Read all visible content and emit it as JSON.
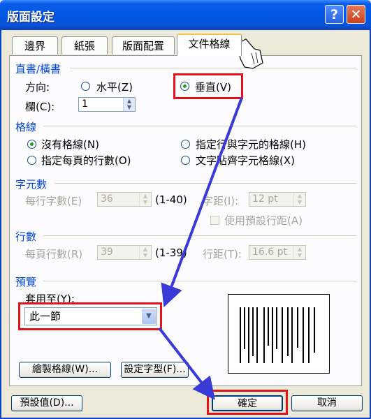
{
  "window": {
    "title": "版面設定",
    "help_glyph": "?",
    "close_glyph": "✕"
  },
  "tabs": [
    "邊界",
    "紙張",
    "版面配置",
    "文件格線"
  ],
  "direction_group": {
    "title": "直書/橫書",
    "direction_label": "方向:",
    "horizontal_label": "水平(Z)",
    "vertical_label": "垂直(V)",
    "columns_label": "欄(C):",
    "columns_value": "1"
  },
  "grid_group": {
    "title": "格線",
    "no_grid": "沒有格線(N)",
    "lines_per_page": "指定每頁的行數(O)",
    "lines_and_chars": "指定行與字元的格線(H)",
    "snap_to_chars": "文字貼齊字元格線(X)"
  },
  "chars_group": {
    "title": "字元數",
    "per_line_label": "每行字數(E)",
    "per_line_value": "36",
    "per_line_range": "(1-40)",
    "pitch_label": "字距(I):",
    "pitch_value": "12 pt",
    "default_pitch_label": "使用預設行距(A)"
  },
  "lines_group": {
    "title": "行數",
    "per_page_label": "每頁行數(R)",
    "per_page_value": "39",
    "per_page_range": "(1-39)",
    "pitch_label": "行距(T):",
    "pitch_value": "16.6 pt"
  },
  "preview_group": {
    "title": "預覽",
    "apply_to_label": "套用至(Y):",
    "apply_to_value": "此一節"
  },
  "buttons": {
    "draw_grid": "繪製格線(W)...",
    "set_font": "設定字型(F)...",
    "default": "預設值(D)...",
    "ok": "確定",
    "cancel": "取消"
  },
  "annotation_color": "#e2141a",
  "arrow_color": "#3a3ad6"
}
